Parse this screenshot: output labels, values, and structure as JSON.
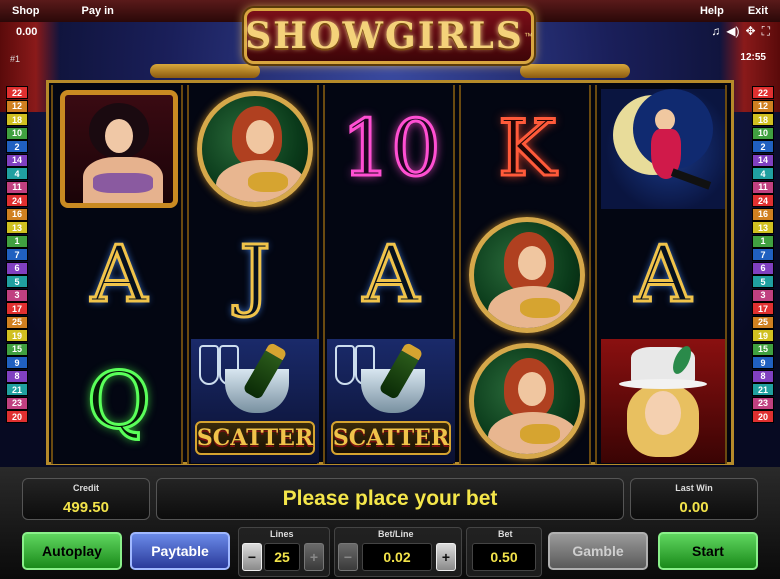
{
  "topbar": {
    "shop_label": "Shop",
    "payin_label": "Pay in",
    "help_label": "Help",
    "exit_label": "Exit",
    "balance": "0.00",
    "line_indicator": "#1",
    "clock": "12:55"
  },
  "game": {
    "title": "SHOWGIRLS",
    "trademark": "™"
  },
  "paylines_left": [
    "22",
    "12",
    "18",
    "10",
    "2",
    "14",
    "4",
    "11",
    "24",
    "16",
    "13",
    "1",
    "7",
    "6",
    "5",
    "3",
    "17",
    "25",
    "19",
    "15",
    "9",
    "8",
    "21",
    "23",
    "20"
  ],
  "paylines_right": [
    "22",
    "12",
    "18",
    "10",
    "2",
    "14",
    "4",
    "11",
    "24",
    "16",
    "13",
    "1",
    "7",
    "6",
    "5",
    "3",
    "17",
    "25",
    "19",
    "15",
    "9",
    "8",
    "21",
    "23",
    "20"
  ],
  "reels": [
    [
      "Brunette Showgirl",
      "A",
      "Q"
    ],
    [
      "Redhead Showgirl",
      "J",
      "Scatter"
    ],
    [
      "10",
      "A",
      "Scatter"
    ],
    [
      "K",
      "Redhead Showgirl",
      "Redhead Showgirl"
    ],
    [
      "Moon Showgirl",
      "A",
      "Top Hat Showgirl"
    ]
  ],
  "scatter_text": "SCATTER",
  "panel": {
    "credit_label": "Credit",
    "credit_value": "499.50",
    "message": "Please place your bet",
    "lastwin_label": "Last Win",
    "lastwin_value": "0.00",
    "autoplay_label": "Autoplay",
    "paytable_label": "Paytable",
    "lines_label": "Lines",
    "lines_value": "25",
    "betline_label": "Bet/Line",
    "betline_value": "0.02",
    "bet_label": "Bet",
    "bet_value": "0.50",
    "gamble_label": "Gamble",
    "start_label": "Start",
    "minus": "−",
    "plus": "+"
  },
  "icons": [
    "music-note-icon",
    "sound-icon",
    "settings-icon",
    "fullscreen-icon"
  ],
  "colors": {
    "accent_gold": "#f0c34a",
    "value_yellow": "#f2e34a",
    "button_green": "#1a8a1a",
    "button_blue": "#2a3a9a"
  }
}
